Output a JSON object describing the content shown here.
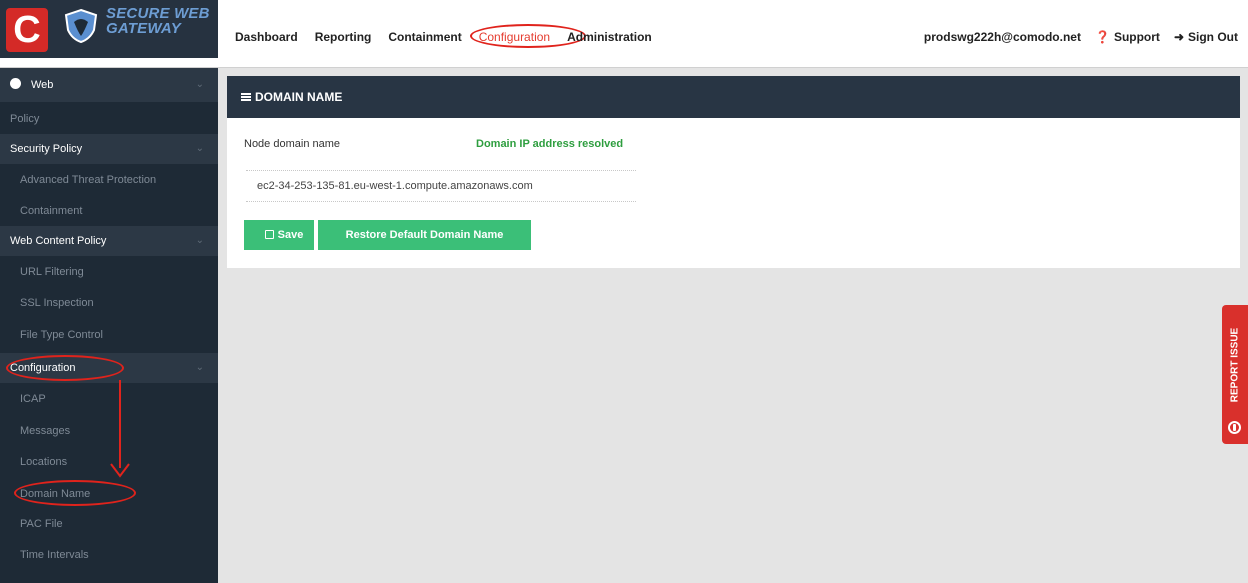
{
  "header": {
    "logo_letter": "C",
    "logo_line1": "SECURE WEB",
    "logo_line2": "GATEWAY",
    "nav": [
      "Dashboard",
      "Reporting",
      "Containment",
      "Configuration",
      "Administration"
    ],
    "active_nav": "Configuration",
    "user_email": "prodswg222h@comodo.net",
    "support_label": "Support",
    "signout_label": "Sign Out"
  },
  "sidebar": {
    "web": "Web",
    "policy": "Policy",
    "security_policy": "Security Policy",
    "advanced_threat_protection": "Advanced Threat Protection",
    "containment": "Containment",
    "web_content_policy": "Web Content Policy",
    "url_filtering": "URL Filtering",
    "ssl_inspection": "SSL Inspection",
    "file_type_control": "File Type Control",
    "configuration": "Configuration",
    "icap": "ICAP",
    "messages": "Messages",
    "locations": "Locations",
    "domain_name": "Domain Name",
    "pac_file": "PAC File",
    "time_intervals": "Time Intervals"
  },
  "panel": {
    "title": "DOMAIN NAME",
    "field_label": "Node domain name",
    "status": "Domain IP address resolved",
    "domain_value": "ec2-34-253-135-81.eu-west-1.compute.amazonaws.com",
    "save_label": "Save",
    "restore_label": "Restore Default Domain Name"
  },
  "report_issue": "REPORT ISSUE",
  "colors": {
    "sidebar_bg": "#1e2a36",
    "header_bg": "#283544",
    "accent_green": "#3bbf78",
    "status_green": "#2e9e3f",
    "brand_red": "#d42a27",
    "annotation_red": "#e0231c"
  }
}
